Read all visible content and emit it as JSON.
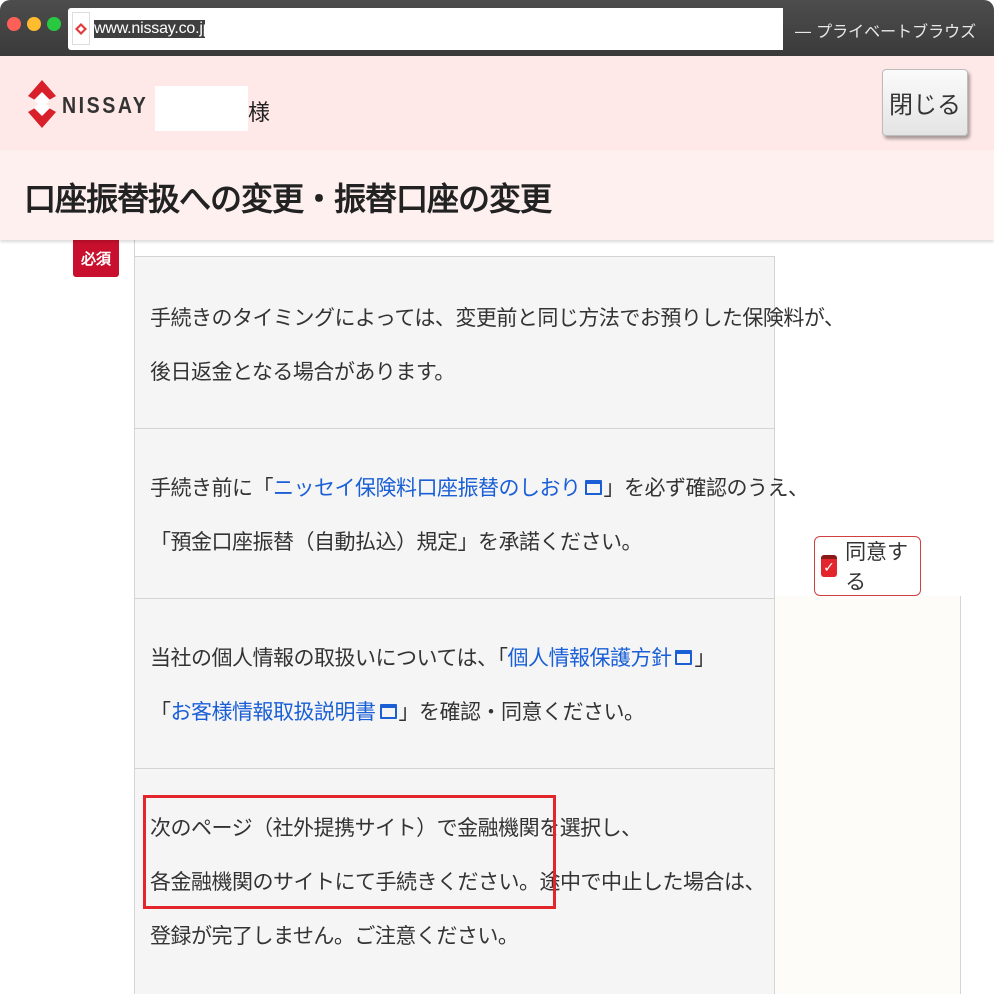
{
  "browser": {
    "url": "www.nissay.co.jp/",
    "mode_label": "― プライベートブラウズ"
  },
  "header": {
    "logo_text": "NISSAY",
    "honorific": "様",
    "close_label": "閉じる"
  },
  "page": {
    "title": "口座振替扱への変更・振替口座の変更"
  },
  "form": {
    "required_badge": "必須",
    "agree_label": "同意する",
    "agree_checked": true,
    "rows": [
      {
        "line1": "手続きのタイミングによっては、変更前と同じ方法でお預りした保険料が、",
        "line2": "後日返金となる場合があります。"
      },
      {
        "line1_pre": "手続き前に「",
        "line1_link": "ニッセイ保険料口座振替のしおり",
        "line1_post": "」を必ず確認のうえ、",
        "line2": "「預金口座振替（自動払込）規定」を承諾ください。"
      },
      {
        "line1_pre": "当社の個人情報の取扱いについては、「",
        "line1_link": "個人情報保護方針",
        "line1_post": "」",
        "line2_pre": "「",
        "line2_link": "お客様情報取扱説明書",
        "line2_post": "」を確認・同意ください。"
      },
      {
        "line1": "次のページ（社外提携サイト）で金融機関を選択し、",
        "line2": "各金融機関のサイトにて手続きください。途中で中止した場合は、",
        "line3": "登録が完了しません。ご注意ください。"
      }
    ]
  },
  "colors": {
    "brand_red": "#c8102e",
    "link_blue": "#1a5fd6",
    "header_pink": "#ffe8e8"
  }
}
